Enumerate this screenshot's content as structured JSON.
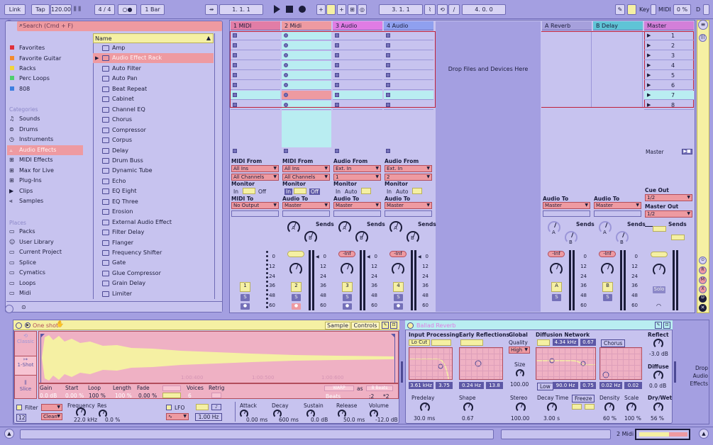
{
  "toolbar": {
    "link": "Link",
    "tap": "Tap",
    "tempo": "120.00",
    "sig_num": "4",
    "sig_den": "4",
    "quant": "1 Bar",
    "pos": "1.  1.  1",
    "loop_start": "3.  1.  1",
    "loop_len": "4.  0.  0",
    "key": "Key",
    "midi": "MIDI",
    "cpu": "0 %",
    "d": "D"
  },
  "browser": {
    "search_placeholder": "Search (Cmd + F)",
    "collections": [
      {
        "label": "Favorites",
        "color": "#e0303b"
      },
      {
        "label": "Favorite Guitar",
        "color": "#f28b2d"
      },
      {
        "label": "Racks",
        "color": "#f0d43a"
      },
      {
        "label": "Perc Loops",
        "color": "#4fcf6e"
      },
      {
        "label": "808",
        "color": "#3d7fe0"
      }
    ],
    "categories_header": "Categories",
    "categories": [
      "Sounds",
      "Drums",
      "Instruments",
      "Audio Effects",
      "MIDI Effects",
      "Max for Live",
      "Plug-Ins",
      "Clips",
      "Samples"
    ],
    "places_header": "Places",
    "places": [
      "Packs",
      "User Library",
      "Current Project",
      "Splice",
      "Cymatics",
      "Loops",
      "Midi"
    ],
    "column_name": "Name",
    "items": [
      "Amp",
      "Audio Effect Rack",
      "Auto Filter",
      "Auto Pan",
      "Beat Repeat",
      "Cabinet",
      "Channel EQ",
      "Chorus",
      "Compressor",
      "Corpus",
      "Delay",
      "Drum Buss",
      "Dynamic Tube",
      "Echo",
      "EQ Eight",
      "EQ Three",
      "Erosion",
      "External Audio Effect",
      "Filter Delay",
      "Flanger",
      "Frequency Shifter",
      "Gate",
      "Glue Compressor",
      "Grain Delay",
      "Limiter"
    ]
  },
  "tracks": [
    {
      "name": "1 MIDI",
      "from_label": "MIDI From",
      "from": "All Ins",
      "chan": "All Channels",
      "monitor": "Monitor",
      "m_in": "In",
      "m_auto": "",
      "m_off": "Off",
      "to_label": "MIDI To",
      "to": "No Output",
      "vol": "",
      "num": "1"
    },
    {
      "name": "2 Midi",
      "from_label": "MIDI From",
      "from": "All Ins",
      "chan": "All Channels",
      "monitor": "Monitor",
      "m_in": "In",
      "m_auto": "",
      "m_off": "Off",
      "to_label": "Audio To",
      "to": "Master",
      "vol": "",
      "num": "2"
    },
    {
      "name": "3 Audio",
      "from_label": "Audio From",
      "from": "Ext. In",
      "chan": "1",
      "monitor": "Monitor",
      "m_in": "In",
      "m_auto": "Auto",
      "m_off": "",
      "to_label": "Audio To",
      "to": "Master",
      "vol": "-Inf",
      "num": "3"
    },
    {
      "name": "4 Audio",
      "from_label": "Audio From",
      "from": "Ext. In",
      "chan": "2",
      "monitor": "Monitor",
      "m_in": "In",
      "m_auto": "Auto",
      "m_off": "",
      "to_label": "Audio To",
      "to": "Master",
      "vol": "-Inf",
      "num": "4"
    }
  ],
  "drop_text": "Drop Files and Devices Here",
  "returns": [
    {
      "name": "A Reverb",
      "to_label": "Audio To",
      "to": "Master",
      "vol": "-Inf",
      "letter": "A"
    },
    {
      "name": "B Delay",
      "to_label": "Audio To",
      "to": "Master",
      "vol": "-Inf",
      "letter": "B"
    }
  ],
  "master": {
    "name": "Master",
    "scenes": [
      "1",
      "2",
      "3",
      "4",
      "5",
      "6",
      "7",
      "8"
    ],
    "cue_label": "Cue Out",
    "cue": "1/2",
    "out_label": "Master Out",
    "out": "1/2",
    "solo": "Solo",
    "footer": "Master"
  },
  "sends_label": "Sends",
  "send_a": "A",
  "send_b": "B",
  "meter_ticks": [
    "0",
    "12",
    "24",
    "36",
    "48",
    "60"
  ],
  "sampler": {
    "title": "One shot",
    "tab_sample": "Sample",
    "tab_controls": "Controls",
    "classic": "Classic",
    "oneshot": "1-Shot",
    "slice": "Slice",
    "time1": "1:00:400",
    "time2": "1:00:500",
    "time3": "1:00:600",
    "gain_l": "Gain",
    "gain": "0.0 dB",
    "start_l": "Start",
    "start": "0.00 %",
    "loop_l": "Loop",
    "loop": "100 %",
    "length_l": "Length",
    "length": "100 %",
    "fade_l": "Fade",
    "fade": "0.00 %",
    "voices_l": "Voices",
    "voices": "6",
    "retrig_l": "Retrig",
    "warp": "WARP",
    "beats": "Beats",
    "as": "as",
    "beats_val": "8 Beats",
    "half": ":2",
    "dbl": "*2",
    "filter": "Filter",
    "filter_val": "12",
    "clean": "Clean",
    "freq_l": "Frequency",
    "freq": "22.0 kHz",
    "res_l": "Res",
    "res": "0.0 %",
    "lfo": "LFO",
    "lfo_rate": "1.00 Hz",
    "attack_l": "Attack",
    "attack": "0.00 ms",
    "decay_l": "Decay",
    "decay": "600 ms",
    "sustain_l": "Sustain",
    "sustain": "0.0 dB",
    "release_l": "Release",
    "release": "50.0 ms",
    "volume_l": "Volume",
    "volume": "-12.0 dB"
  },
  "reverb": {
    "title": "Ballad Reverb",
    "input": "Input Processing",
    "locut": "Lo Cut",
    "early": "Early Reflections",
    "global": "Global",
    "quality_l": "Quality",
    "quality": "High",
    "diffusion": "Diffusion Network",
    "chorus": "Chorus",
    "f1": "3.61 kHz",
    "f2": "3.75",
    "spin1": "0.24 Hz",
    "spin2": "13.8",
    "size_l": "Size",
    "size": "100.00",
    "hi": "4.34 kHz",
    "hi2": "0.67",
    "low_l": "Low",
    "low": "90.0 Hz",
    "low2": "0.75",
    "ch1": "0.02 Hz",
    "ch2": "0.02",
    "reflect_l": "Reflect",
    "reflect": "-3.0 dB",
    "diffuse_l": "Diffuse",
    "diffuse": "0.0 dB",
    "predelay_l": "Predelay",
    "predelay": "30.0 ms",
    "shape_l": "Shape",
    "shape": "0.67",
    "stereo_l": "Stereo",
    "stereo": "100.00",
    "decay_l": "Decay Time",
    "decay": "3.00 s",
    "freeze": "Freeze",
    "density_l": "Density",
    "density": "60 %",
    "scale_l": "Scale",
    "scale": "100 %",
    "drywet_l": "Dry/Wet",
    "drywet": "56 %"
  },
  "drop_effects": "Drop Audio Effects",
  "status": {
    "track": "2 Midi"
  }
}
